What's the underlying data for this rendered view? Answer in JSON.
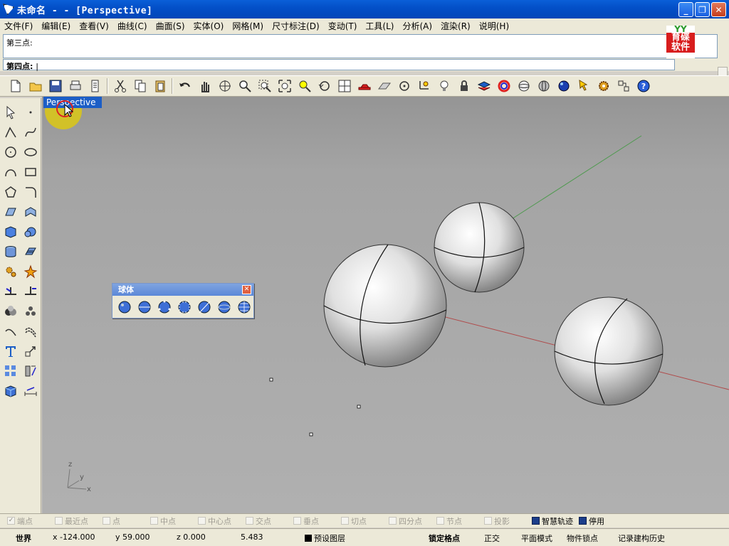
{
  "window": {
    "title": "未命名 -  - [Perspective]",
    "buttons": {
      "minimize": "_",
      "maximize": "❐",
      "close": "✕"
    }
  },
  "menu": [
    "文件(F)",
    "编辑(E)",
    "查看(V)",
    "曲线(C)",
    "曲面(S)",
    "实体(O)",
    "网格(M)",
    "尺寸标注(D)",
    "变动(T)",
    "工具(L)",
    "分析(A)",
    "渲染(R)",
    "说明(H)"
  ],
  "command": {
    "history": "第三点:",
    "prompt": "第四点:",
    "cursor": "|"
  },
  "logo": {
    "top": "YY",
    "bottom1": "育碟",
    "bottom2": "软件"
  },
  "viewport": {
    "title": "Perspective",
    "axis_labels": {
      "z": "z",
      "y": "y",
      "x": "x"
    }
  },
  "sphere_toolbar": {
    "title": "球体",
    "close": "✕"
  },
  "osnaps": [
    {
      "label": "端点",
      "checked": true,
      "active": false
    },
    {
      "label": "最近点",
      "checked": false,
      "active": false
    },
    {
      "label": "点",
      "checked": false,
      "active": false
    },
    {
      "label": "中点",
      "checked": false,
      "active": false
    },
    {
      "label": "中心点",
      "checked": false,
      "active": false
    },
    {
      "label": "交点",
      "checked": false,
      "active": false
    },
    {
      "label": "垂点",
      "checked": false,
      "active": false
    },
    {
      "label": "切点",
      "checked": false,
      "active": false
    },
    {
      "label": "四分点",
      "checked": false,
      "active": false
    },
    {
      "label": "节点",
      "checked": false,
      "active": false
    },
    {
      "label": "投影",
      "checked": false,
      "active": false
    },
    {
      "label": "智慧轨迹",
      "checked": true,
      "active": false
    },
    {
      "label": "停用",
      "checked": true,
      "active": true
    }
  ],
  "status": {
    "coord_system": "世界",
    "x": "x -124.000",
    "y": "y 59.000",
    "z": "z 0.000",
    "distance": "5.483",
    "layer": "预设图层",
    "grid_snap": "锁定格点",
    "ortho": "正交",
    "planar": "平面模式",
    "osnap": "物件锁点",
    "history": "记录建构历史"
  },
  "colors": {
    "titlebar": "#0350c8",
    "viewport_bg": "#a8a8a8",
    "x_axis": "#b04040",
    "y_axis": "#3f8f3f",
    "viewport_title_bg": "#1c5ec6"
  }
}
